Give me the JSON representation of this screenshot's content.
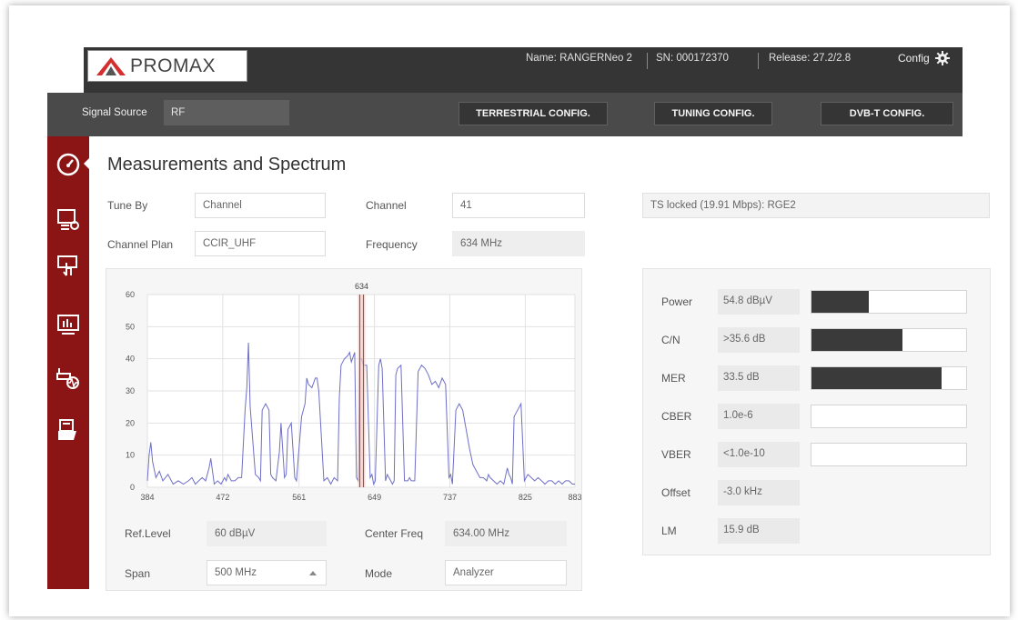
{
  "header": {
    "brand": "PROMAX",
    "device_name": "Name: RANGERNeo 2",
    "serial": "SN: 000172370",
    "release": "Release: 27.2/2.8",
    "config_label": "Config"
  },
  "subbar": {
    "signal_source_label": "Signal Source",
    "signal_source_value": "RF",
    "buttons": [
      "TERRESTRIAL CONFIG.",
      "TUNING CONFIG.",
      "DVB-T CONFIG."
    ]
  },
  "sidebar": {
    "items": [
      "gauge-icon",
      "settings-screen-icon",
      "hand-touch-icon",
      "monitor-chart-icon",
      "signal-wave-icon",
      "folder-icon"
    ]
  },
  "page": {
    "title": "Measurements and Spectrum",
    "tune_by_label": "Tune By",
    "tune_by_value": "Channel",
    "channel_label": "Channel",
    "channel_value": "41",
    "channel_plan_label": "Channel Plan",
    "channel_plan_value": "CCIR_UHF",
    "frequency_label": "Frequency",
    "frequency_value": "634 MHz",
    "ts_status": "TS locked (19.91 Mbps): RGE2"
  },
  "spectrum_controls": {
    "ref_level_label": "Ref.Level",
    "ref_level_value": "60 dBµV",
    "center_freq_label": "Center Freq",
    "center_freq_value": "634.00 MHz",
    "span_label": "Span",
    "span_value": "500 MHz",
    "mode_label": "Mode",
    "mode_value": "Analyzer"
  },
  "measurements": [
    {
      "label": "Power",
      "value": "54.8 dBµV",
      "level": 0.37
    },
    {
      "label": "C/N",
      "value": ">35.6 dB",
      "level": 0.59
    },
    {
      "label": "MER",
      "value": "33.5 dB",
      "level": 0.84
    },
    {
      "label": "CBER",
      "value": "1.0e-6",
      "level": 0
    },
    {
      "label": "VBER",
      "value": "<1.0e-10",
      "level": 0
    },
    {
      "label": "Offset",
      "value": "-3.0 kHz"
    },
    {
      "label": "LM",
      "value": "15.9 dB"
    }
  ],
  "colors": {
    "sidebar": "#8b1414",
    "trace": "#6f6fc8",
    "marker": "#c0392b"
  },
  "chart_data": {
    "type": "line",
    "title": "",
    "xlabel": "",
    "ylabel": "",
    "xlim": [
      384,
      883
    ],
    "ylim": [
      0,
      60
    ],
    "x_ticks": [
      "384",
      "472",
      "561",
      "649",
      "737",
      "825",
      "883"
    ],
    "y_ticks": [
      "0",
      "10",
      "20",
      "30",
      "40",
      "50",
      "60"
    ],
    "marker_label": "634",
    "marker_x": 634,
    "grid": true,
    "series": [
      {
        "x": [
          384,
          386,
          388,
          390,
          394,
          398,
          402,
          408,
          414,
          420,
          426,
          432,
          436,
          440,
          444,
          448,
          452,
          456,
          458,
          460,
          462,
          466,
          470,
          474,
          476,
          478,
          482,
          486,
          490,
          494,
          498,
          500,
          502,
          504,
          510,
          514,
          516,
          518,
          522,
          526,
          528,
          530,
          534,
          538,
          540,
          544,
          546,
          548,
          552,
          556,
          558,
          560,
          564,
          568,
          570,
          572,
          576,
          580,
          582,
          584,
          590,
          594,
          596,
          598,
          602,
          606,
          608,
          610,
          614,
          618,
          620,
          622,
          626,
          628,
          630,
          632,
          634,
          636,
          638,
          640,
          644,
          646,
          648,
          650,
          654,
          656,
          658,
          662,
          664,
          666,
          670,
          672,
          674,
          676,
          680,
          684,
          688,
          690,
          692,
          696,
          700,
          704,
          708,
          712,
          716,
          720,
          722,
          724,
          728,
          732,
          736,
          738,
          740,
          744,
          748,
          752,
          756,
          760,
          764,
          768,
          772,
          776,
          780,
          782,
          784,
          788,
          792,
          796,
          800,
          804,
          806,
          808,
          810,
          812,
          816,
          820,
          824,
          828,
          832,
          836,
          840,
          844,
          848,
          852,
          856,
          860,
          864,
          868,
          872,
          876,
          880,
          883
        ],
        "y": [
          2,
          10,
          14,
          8,
          3,
          5,
          2,
          4,
          1,
          2,
          1,
          2,
          3,
          1,
          2,
          3,
          2,
          6,
          9,
          5,
          1,
          2,
          1,
          3,
          2,
          4,
          2,
          2,
          3,
          3,
          24,
          31,
          45,
          25,
          4,
          3,
          2,
          24,
          26,
          24,
          4,
          3,
          2,
          11,
          20,
          3,
          4,
          18,
          20,
          3,
          2,
          9,
          22,
          26,
          34,
          32,
          31,
          34,
          34,
          30,
          2,
          3,
          2,
          1,
          3,
          2,
          28,
          38,
          40,
          41,
          42,
          39,
          42,
          3,
          2,
          40,
          40,
          38,
          38,
          38,
          3,
          4,
          1,
          2,
          38,
          40,
          37,
          2,
          4,
          3,
          1,
          2,
          35,
          37,
          38,
          2,
          2,
          3,
          2,
          2,
          36,
          38,
          37,
          35,
          32,
          33,
          32,
          31,
          34,
          32,
          3,
          4,
          1,
          24,
          26,
          24,
          18,
          12,
          7,
          5,
          3,
          3,
          2,
          4,
          3,
          2,
          1,
          2,
          1,
          6,
          4,
          3,
          1,
          22,
          24,
          26,
          2,
          4,
          3,
          2,
          3,
          2,
          1,
          2,
          2,
          1,
          2,
          1,
          2,
          2,
          1,
          1
        ]
      }
    ]
  }
}
